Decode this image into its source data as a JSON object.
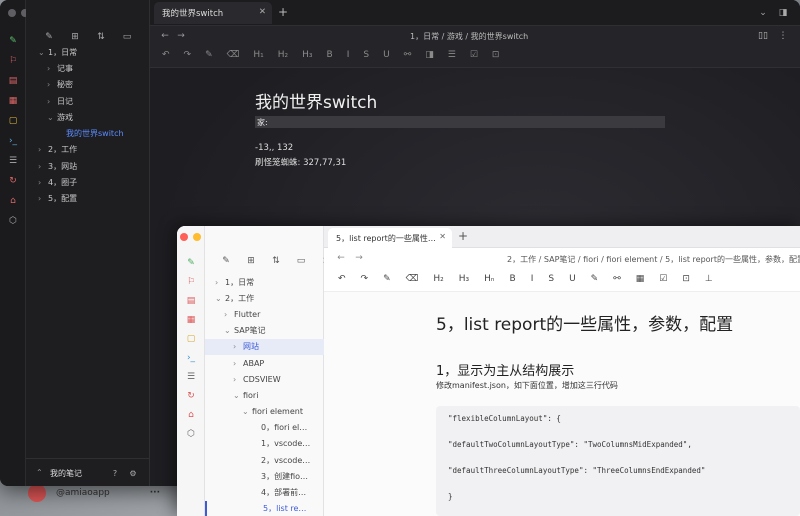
{
  "desktop": {
    "handle": "@amiaoapp",
    "more": "···"
  },
  "dark": {
    "tab_title": "我的世界switch",
    "tab_close": "✕",
    "new_tab": "+",
    "breadcrumb": "1，日常 / 游戏 / 我的世界switch",
    "toolbar": [
      "↶",
      "↷",
      "✎",
      "⌫",
      "H₁",
      "H₂",
      "H₃",
      "B",
      "I",
      "S",
      "U",
      "⚯",
      "◨",
      "☰",
      "☑",
      "⊡"
    ],
    "heading": "我的世界switch",
    "line_label": "家:",
    "coords": "-13,, 132",
    "farm": "刷怪笼蜘蛛: 327,77,31",
    "tree": [
      {
        "label": "1，日常",
        "indent": 0,
        "arrow": "⌄"
      },
      {
        "label": "记事",
        "indent": 1,
        "arrow": "›"
      },
      {
        "label": "秘密",
        "indent": 1,
        "arrow": "›"
      },
      {
        "label": "日记",
        "indent": 1,
        "arrow": "›"
      },
      {
        "label": "游戏",
        "indent": 1,
        "arrow": "⌄"
      },
      {
        "label": "我的世界switch",
        "indent": 2,
        "arrow": "",
        "selected": true
      },
      {
        "label": "2，工作",
        "indent": 0,
        "arrow": "›"
      },
      {
        "label": "3，网站",
        "indent": 0,
        "arrow": "›"
      },
      {
        "label": "4，圈子",
        "indent": 0,
        "arrow": "›"
      },
      {
        "label": "5，配置",
        "indent": 0,
        "arrow": "›"
      }
    ],
    "footer_label": "我的笔记"
  },
  "light": {
    "tab_title": "5，list report的一些属性…",
    "tab_close": "✕",
    "new_tab": "+",
    "breadcrumb": "2，工作 / SAP笔记 / fiori / fiori element / 5，list report的一些属性，参数，配置",
    "toolbar": [
      "↶",
      "↷",
      "✎",
      "⌫",
      "H₂",
      "H₃",
      "Hₙ",
      "B",
      "I",
      "S",
      "U",
      "✎",
      "⚯",
      "▦",
      "☑",
      "⊡",
      "⊥"
    ],
    "heading": "5，list report的一些属性，参数，配置",
    "subheading": "1，显示为主从结构展示",
    "paragraph": "修改manifest.json，如下面位置，增加这三行代码",
    "code": [
      "\"flexibleColumnLayout\": {",
      "\"defaultTwoColumnLayoutType\": \"TwoColumnsMidExpanded\",",
      "\"defaultThreeColumnLayoutType\": \"ThreeColumnsEndExpanded\"",
      "}"
    ],
    "tree": [
      {
        "label": "1，日常",
        "indent": 0,
        "arrow": "›"
      },
      {
        "label": "2，工作",
        "indent": 0,
        "arrow": "⌄"
      },
      {
        "label": "Flutter",
        "indent": 1,
        "arrow": "›"
      },
      {
        "label": "SAP笔记",
        "indent": 1,
        "arrow": "⌄"
      },
      {
        "label": "网站",
        "indent": 2,
        "arrow": "›",
        "selected": true
      },
      {
        "label": "ABAP",
        "indent": 2,
        "arrow": "›"
      },
      {
        "label": "CDSVIEW",
        "indent": 2,
        "arrow": "›"
      },
      {
        "label": "fiori",
        "indent": 2,
        "arrow": "⌄"
      },
      {
        "label": "fiori element",
        "indent": 3,
        "arrow": "⌄"
      },
      {
        "label": "0，fiori el…",
        "indent": 4,
        "arrow": ""
      },
      {
        "label": "1，vscode…",
        "indent": 4,
        "arrow": ""
      },
      {
        "label": "2，vscode…",
        "indent": 4,
        "arrow": ""
      },
      {
        "label": "3，创建fio…",
        "indent": 4,
        "arrow": ""
      },
      {
        "label": "4，部署前…",
        "indent": 4,
        "arrow": ""
      },
      {
        "label": "5，list re…",
        "indent": 4,
        "arrow": "",
        "current": true
      }
    ]
  },
  "colors": {
    "accent": "#3d5bd9",
    "dark_bg": "#202024",
    "light_bg": "#ffffff"
  }
}
